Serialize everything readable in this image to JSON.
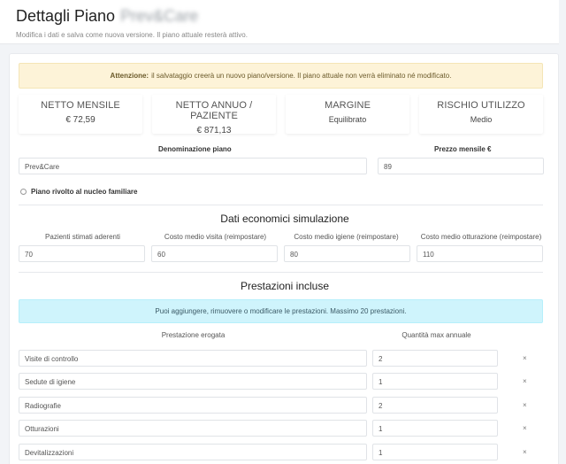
{
  "header": {
    "title": "Dettagli Piano",
    "plan_name": "Prev&Care",
    "subtitle": "Modifica i dati e salva come nuova versione. Il piano attuale resterà attivo."
  },
  "warning": {
    "strong": "Attenzione:",
    "text": "il salvataggio creerà un nuovo piano/versione. Il piano attuale non verrà eliminato né modificato."
  },
  "stats": [
    {
      "label": "NETTO MENSILE",
      "value": "€ 72,59"
    },
    {
      "label": "NETTO ANNUO / PAZIENTE",
      "value": "€ 871,13"
    },
    {
      "label": "MARGINE",
      "value": "Equilibrato"
    },
    {
      "label": "RISCHIO UTILIZZO",
      "value": "Medio"
    }
  ],
  "form": {
    "name_label": "Denominazione piano",
    "name_value": "Prev&Care",
    "price_label": "Prezzo mensile €",
    "price_value": "89",
    "family_label": "Piano rivolto al nucleo familiare"
  },
  "economics": {
    "title": "Dati economici simulazione",
    "fields": [
      {
        "label": "Pazienti stimati aderenti",
        "value": "70"
      },
      {
        "label": "Costo medio visita (reimpostare)",
        "value": "60"
      },
      {
        "label": "Costo medio igiene (reimpostare)",
        "value": "80"
      },
      {
        "label": "Costo medio otturazione (reimpostare)",
        "value": "110"
      }
    ]
  },
  "services": {
    "title": "Prestazioni incluse",
    "info": "Puoi aggiungere, rimuovere o modificare le prestazioni. Massimo 20 prestazioni.",
    "col_service": "Prestazione erogata",
    "col_qty": "Quantità max annuale",
    "remove_symbol": "×",
    "rows": [
      {
        "name": "Visite di controllo",
        "qty": "2"
      },
      {
        "name": "Sedute di igiene",
        "qty": "1"
      },
      {
        "name": "Radiografie",
        "qty": "2"
      },
      {
        "name": "Otturazioni",
        "qty": "1"
      },
      {
        "name": "Devitalizzazioni",
        "qty": "1"
      }
    ]
  }
}
